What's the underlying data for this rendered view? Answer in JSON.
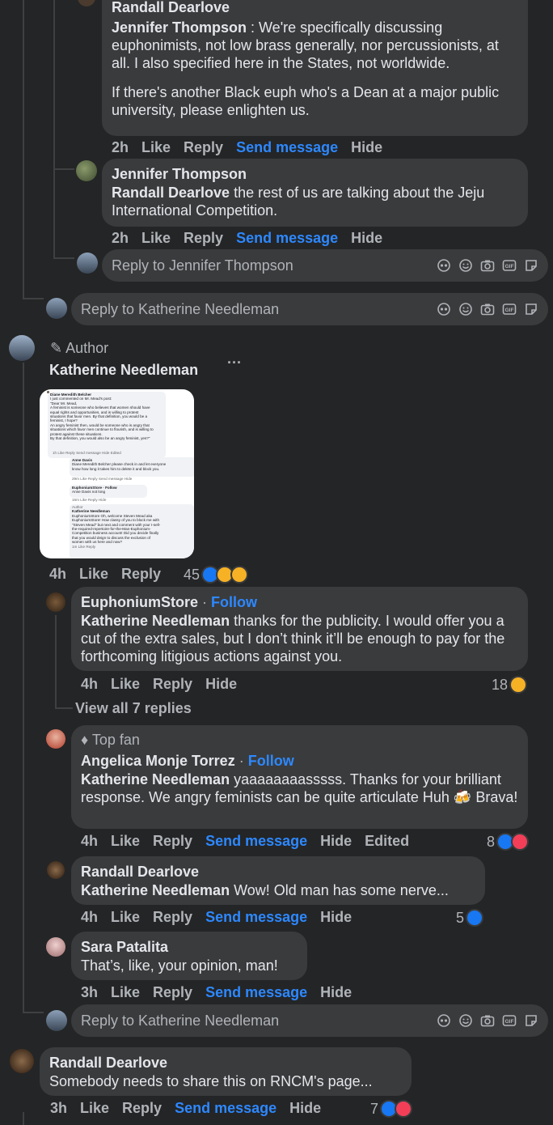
{
  "c1": {
    "name": "Randall Dearlove",
    "mention": "Jennifer Thompson",
    "text1": " : We're specifically discussing euphonimists, not low brass generally, nor percussionists, at all. I also specified here in the States, not worldwide.",
    "text2": "If there's another Black euph who's a Dean at a major public university, please enlighten us.",
    "time": "2h",
    "like": "Like",
    "reply": "Reply",
    "send": "Send message",
    "hide": "Hide"
  },
  "c2": {
    "name": "Jennifer Thompson",
    "mention": "Randall Dearlove",
    "text": " the rest of us are talking about the Jeju International Competition.",
    "time": "2h",
    "like": "Like",
    "reply": "Reply",
    "send": "Send message",
    "hide": "Hide"
  },
  "reply_jennifer": {
    "placeholder": "Reply to Jennifer Thompson"
  },
  "reply_katherine_1": {
    "placeholder": "Reply to Katherine Needleman"
  },
  "c3": {
    "badge": "Author",
    "name": "Katherine Needleman",
    "more": "···",
    "time": "4h",
    "like": "Like",
    "reply": "Reply",
    "reactions": "45",
    "screenshot": {
      "l1": "Diane Meredith Belcher",
      "l2": "I just commented on Mr. Mead's post:",
      "l3": "\"Dear Mr. Mead,",
      "l4": "A feminist is someone who believes that women should have",
      "l5": "equal rights and opportunities, and is willing to protest",
      "l6": "situations that favor men. By that definition, you would be a",
      "l7": "feminist, I hope?",
      "l8": "An angry feminist then, would be someone who is angry that",
      "l9": "situations which favor men continue to flourish, and is willing to",
      "l10": "protest against these situations.",
      "l11": "By that definition, you would also be an angry feminist, yes?\"",
      "l12": "1h  Like  Reply  Send message  Hide  Edited",
      "l13": "Anne Davis",
      "l14": "Diane Meredith Belcher please check in and let everyone",
      "l15": "know how long it takes him to delete it and block you.",
      "l16": "29m  Like  Reply  Send message  Hide",
      "l17": "EuphoniumStore · Follow",
      "l18": "Anne Davis not long",
      "l19": "16m  Like  Reply  Hide",
      "l20": "Author",
      "l21": "Katherine Needleman",
      "l22": "EuphoniumStore Oh, welcome Steven Mead aka",
      "l23": "EuphoniumStore! How classy of you to block me with",
      "l24": "\"Steven Mead\" but next and comment with your I-sell-",
      "l25": "the-required-repertoire-for-the-Man-Euphonium-",
      "l26": "Competition business account! Did you decide finally",
      "l27": "that you would deign to discuss the exclusion of",
      "l28": "women with us here and now?",
      "l29": "1m  Like  Reply"
    }
  },
  "c4": {
    "name": "EuphoniumStore",
    "follow": "Follow",
    "mention": "Katherine Needleman",
    "text": " thanks for the publicity. I would offer you a cut of the extra sales, but I don’t think it’ll be enough to pay for the forthcoming litigious actions against you.",
    "time": "4h",
    "like": "Like",
    "reply": "Reply",
    "hide": "Hide",
    "reactions": "18"
  },
  "view_replies": "View all 7 replies",
  "c5": {
    "badge": "Top fan",
    "name": "Angelica Monje Torrez",
    "follow": "Follow",
    "mention": "Katherine Needleman",
    "text": " yaaaaaaaasssss. Thanks for your brilliant response. We angry feminists can be quite articulate Huh 🍻 Brava!",
    "time": "4h",
    "like": "Like",
    "reply": "Reply",
    "send": "Send message",
    "hide": "Hide",
    "edited": "Edited",
    "reactions": "8"
  },
  "c6": {
    "name": "Randall Dearlove",
    "mention": "Katherine Needleman",
    "text": " Wow! Old man has some nerve...",
    "time": "4h",
    "like": "Like",
    "reply": "Reply",
    "send": "Send message",
    "hide": "Hide",
    "reactions": "5"
  },
  "c7": {
    "name": "Sara Patalita",
    "text": "That’s, like, your opinion, man!",
    "time": "3h",
    "like": "Like",
    "reply": "Reply",
    "send": "Send message",
    "hide": "Hide"
  },
  "reply_katherine_2": {
    "placeholder": "Reply to Katherine Needleman"
  },
  "c8": {
    "name": "Randall Dearlove",
    "text": "Somebody needs to share this on RNCM's page...",
    "time": "3h",
    "like": "Like",
    "reply": "Reply",
    "send": "Send message",
    "hide": "Hide",
    "reactions": "7"
  },
  "colors": {
    "background": "#242526",
    "bubble": "#3a3b3c",
    "link": "#2d88ff",
    "muted": "#b0b3b8",
    "like_blue": "#1877f2",
    "love_red": "#f33e58",
    "haha_yellow": "#f7b125"
  }
}
